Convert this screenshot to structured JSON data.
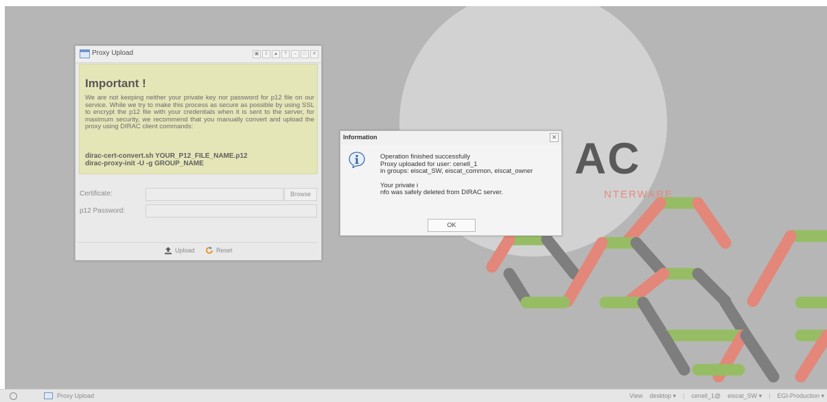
{
  "background": {
    "logo_partial": "AC",
    "logo_tagline_partial": "NTERWARE",
    "colors": {
      "desktop": "#b6b6b6",
      "circle": "#d2d2d2",
      "hex_green": "#96bd64",
      "hex_red": "#e2877a",
      "hex_gray": "#7e7e7e"
    }
  },
  "proxy_window": {
    "title": "Proxy Upload",
    "tool_icons": [
      "restore-icon",
      "pin-icon",
      "minimize-up-icon",
      "help-icon",
      "minimize-icon",
      "maximize-icon",
      "close-icon"
    ],
    "notice": {
      "title": "Important !",
      "body": "We are not keeping neither your private key nor password for p12 file on our service. While we try to make this process as secure as possible by using SSL to encrypt the p12 file with your credentials when it is sent to the server, for maximum security, we recommend that you manually convert and upload the proxy using DIRAC client commands:",
      "cmd1": "dirac-cert-convert.sh YOUR_P12_FILE_NAME.p12",
      "cmd2": "dirac-proxy-init -U -g GROUP_NAME"
    },
    "form": {
      "certificate_label": "Certificate:",
      "certificate_value": "",
      "browse_label": "Browse",
      "password_label": "p12 Password:",
      "password_value": ""
    },
    "footer": {
      "upload_label": "Upload",
      "reset_label": "Reset"
    }
  },
  "info_dialog": {
    "title": "Information",
    "line1": "Operation finished successfully",
    "line2": "Proxy uploaded for user: cenell_1",
    "line3": "in groups: eiscat_SW, eiscat_common, eiscat_owner",
    "line4": "Your private i",
    "line5": "nfo was safely deleted from DIRAC server.",
    "ok_label": "OK"
  },
  "taskbar": {
    "task_label": "Proxy Upload",
    "view_label": "View",
    "desktop_label": "desktop ▾",
    "user_label": "cenell_1@",
    "group_label": "eiscat_SW ▾",
    "setup_label": "EGI-Production ▾"
  }
}
